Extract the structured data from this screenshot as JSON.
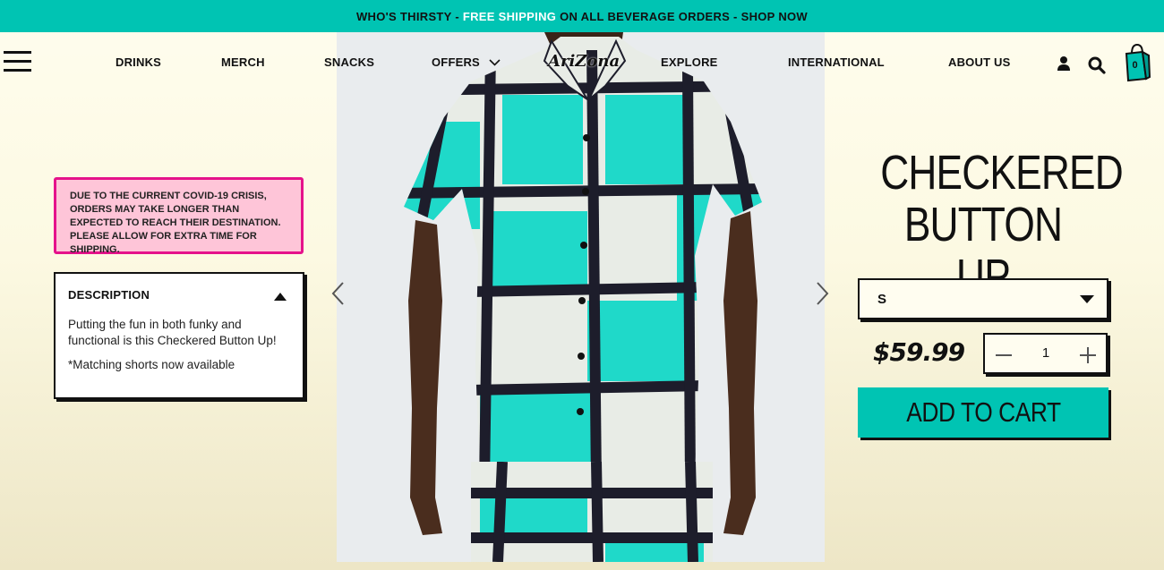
{
  "promo": {
    "part1": "WHO'S THIRSTY - ",
    "highlight": "FREE SHIPPING",
    "part2": " ON ALL BEVERAGE ORDERS - SHOP NOW"
  },
  "nav": {
    "items": [
      {
        "label": "DRINKS"
      },
      {
        "label": "MERCH"
      },
      {
        "label": "SNACKS"
      },
      {
        "label": "OFFERS"
      },
      {
        "label": "EXPLORE"
      },
      {
        "label": "INTERNATIONAL"
      },
      {
        "label": "ABOUT US"
      }
    ],
    "logo": "AriZona",
    "cart_count": "0"
  },
  "notice": "DUE TO THE CURRENT COVID-19 CRISIS, ORDERS MAY TAKE LONGER THAN EXPECTED TO REACH THEIR DESTINATION. PLEASE ALLOW FOR EXTRA TIME FOR SHIPPING.",
  "description": {
    "title": "DESCRIPTION",
    "body": "Putting the fun in both funky and functional is this Checkered Button Up!",
    "note": "*Matching shorts now available"
  },
  "product": {
    "title_line1": "CHECKERED",
    "title_line2": "BUTTON UP",
    "size": "S",
    "price": "$59.99",
    "quantity": "1",
    "add_to_cart": "ADD TO CART"
  },
  "icons": {
    "menu": "hamburger-icon",
    "user": "user-icon",
    "search": "search-icon",
    "cart": "shopping-bag-icon",
    "prev": "chevron-left-icon",
    "next": "chevron-right-icon"
  },
  "colors": {
    "accent": "#00c4b3",
    "notice_bg": "#fec5d8",
    "notice_border": "#e5128b"
  }
}
